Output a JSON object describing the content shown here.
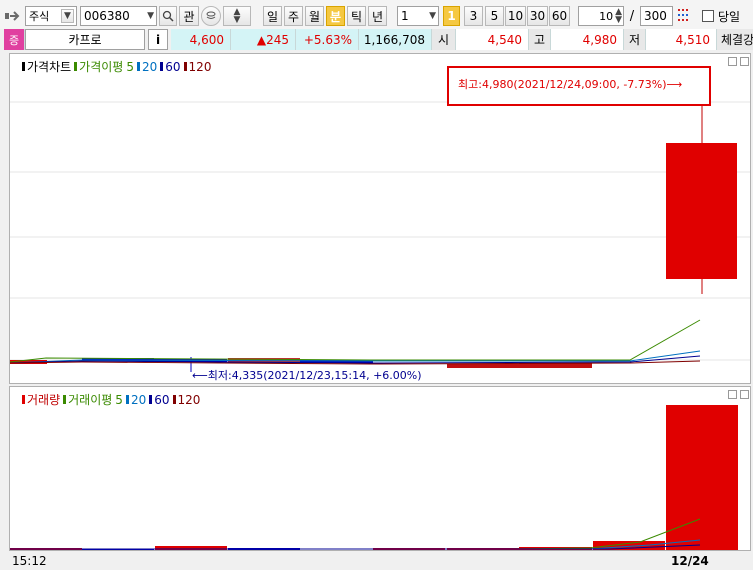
{
  "toolbar": {
    "market": "주식",
    "code": "006380",
    "btn_watch": "관",
    "periods": [
      "일",
      "주",
      "월",
      "분",
      "틱",
      "년"
    ],
    "active_period": "분",
    "interval_value": "1",
    "intervals": [
      "1",
      "3",
      "5",
      "10",
      "30",
      "60"
    ],
    "active_interval": "1",
    "display_count": "10",
    "slash": "/",
    "total_count": "300",
    "today_label": "당일"
  },
  "info": {
    "badge": "증",
    "name": "카프로",
    "info_btn": "i",
    "price": "4,600",
    "change": "▲245",
    "change_pct": "+5.63%",
    "volume": "1,166,708",
    "open_label": "시",
    "open": "4,540",
    "high_label": "고",
    "high": "4,980",
    "low_label": "저",
    "low": "4,510",
    "trade_label": "체결강"
  },
  "price_panel": {
    "title": "가격차트",
    "ma_title": "가격이평",
    "ma_periods": [
      "5",
      "20",
      "60",
      "120"
    ],
    "high_annotation": "최고:4,980(2021/12/24,09:00, -7.73%)⟶",
    "low_annotation": "⟵최저:4,335(2021/12/23,15:14, +6.00%)"
  },
  "volume_panel": {
    "title": "거래량",
    "ma_title": "거래이평",
    "ma_periods": [
      "5",
      "20",
      "60",
      "120"
    ]
  },
  "axis": {
    "left_time": "15:12",
    "right_date": "12/24"
  },
  "colors": {
    "up": "#e00000",
    "down": "#0000c0",
    "ma5": "#3a8a00",
    "ma20": "#0070c0",
    "ma60": "#000090",
    "ma120": "#800000",
    "info_bg": "#d4f4f6",
    "highlight": "#f5c842"
  }
}
